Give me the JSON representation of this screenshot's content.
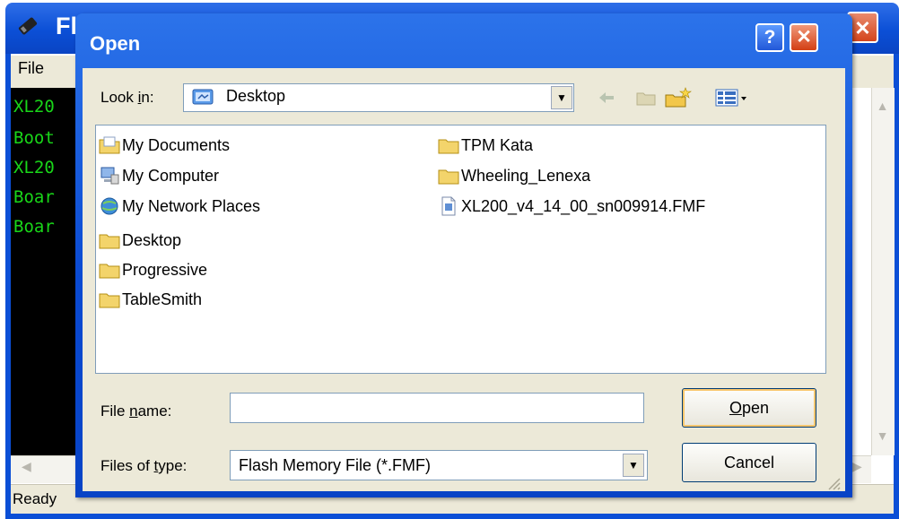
{
  "background_window": {
    "title": "Fl",
    "menu": [
      "File"
    ],
    "console_lines": [
      "XL20",
      "Boot",
      "XL20",
      "Boar",
      "Boar"
    ],
    "status": "Ready"
  },
  "dialog": {
    "title": "Open",
    "help_label": "?",
    "close_label": "✕",
    "look_in": {
      "label_pre": "Look ",
      "label_hot": "i",
      "label_post": "n:",
      "value": "Desktop"
    },
    "files": [
      {
        "name": "My Documents",
        "icon": "my-documents-icon"
      },
      {
        "name": "My Computer",
        "icon": "my-computer-icon"
      },
      {
        "name": "My Network Places",
        "icon": "network-places-icon"
      },
      {
        "name": "Desktop",
        "icon": "folder-icon"
      },
      {
        "name": "Progressive",
        "icon": "folder-icon"
      },
      {
        "name": "TableSmith",
        "icon": "folder-icon"
      },
      {
        "name": "TPM Kata",
        "icon": "folder-icon"
      },
      {
        "name": "Wheeling_Lenexa",
        "icon": "folder-icon"
      },
      {
        "name": "XL200_v4_14_00_sn009914.FMF",
        "icon": "file-icon"
      }
    ],
    "file_name": {
      "label_pre": "File ",
      "label_hot": "n",
      "label_post": "ame:",
      "value": ""
    },
    "file_type": {
      "label_pre": "Files of ",
      "label_hot": "t",
      "label_post": "ype:",
      "value": "Flash Memory File (*.FMF)"
    },
    "open_button": {
      "hot": "O",
      "rest": "pen"
    },
    "cancel_button": "Cancel"
  },
  "colors": {
    "titlebar": "#0b4fd6",
    "dialog_face": "#ece9d8",
    "console_text": "#19d619"
  }
}
